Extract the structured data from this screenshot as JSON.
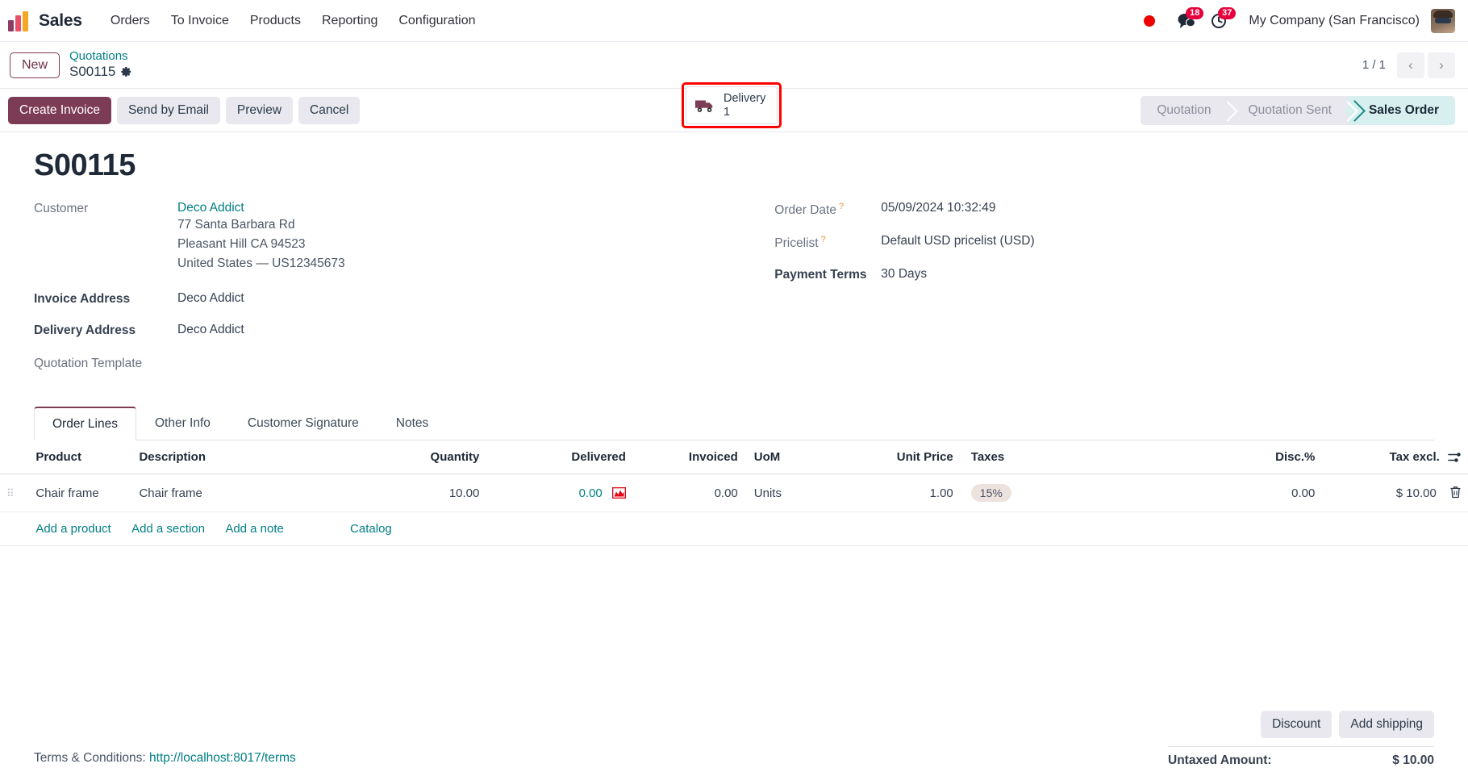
{
  "navbar": {
    "app_name": "Sales",
    "menu": [
      {
        "label": "Orders"
      },
      {
        "label": "To Invoice"
      },
      {
        "label": "Products"
      },
      {
        "label": "Reporting"
      },
      {
        "label": "Configuration"
      }
    ],
    "messages_badge": "18",
    "activities_badge": "37",
    "company": "My Company (San Francisco)",
    "recording_indicator": "recording-dot"
  },
  "control_panel": {
    "new_button": "New",
    "breadcrumb_parent": "Quotations",
    "breadcrumb_current": "S00115",
    "smart_button": {
      "label": "Delivery",
      "count": "1",
      "highlight_color": "#ff0000"
    },
    "pager": {
      "text": "1 / 1",
      "prev": "‹",
      "next": "›"
    }
  },
  "actions": {
    "buttons": [
      {
        "label": "Create Invoice",
        "primary": true
      },
      {
        "label": "Send by Email",
        "primary": false
      },
      {
        "label": "Preview",
        "primary": false
      },
      {
        "label": "Cancel",
        "primary": false
      }
    ]
  },
  "statusbar": {
    "steps": [
      {
        "label": "Quotation",
        "active": false
      },
      {
        "label": "Quotation Sent",
        "active": false
      },
      {
        "label": "Sales Order",
        "active": true
      }
    ],
    "active_color": "#d7f0ef"
  },
  "record": {
    "title": "S00115",
    "customer_label": "Customer",
    "customer_name": "Deco Addict",
    "address_line1": "77 Santa Barbara Rd",
    "address_line2": "Pleasant Hill CA 94523",
    "address_line3": "United States — US12345673",
    "invoice_address_label": "Invoice Address",
    "invoice_address_value": "Deco Addict",
    "delivery_address_label": "Delivery Address",
    "delivery_address_value": "Deco Addict",
    "quotation_template_label": "Quotation Template",
    "quotation_template_value": "",
    "order_date_label": "Order Date",
    "order_date_value": "05/09/2024 10:32:49",
    "pricelist_label": "Pricelist",
    "pricelist_value": "Default USD pricelist (USD)",
    "payment_terms_label": "Payment Terms",
    "payment_terms_value": "30 Days",
    "help_mark": "?"
  },
  "notebook": {
    "tabs": [
      {
        "label": "Order Lines",
        "active": true
      },
      {
        "label": "Other Info",
        "active": false
      },
      {
        "label": "Customer Signature",
        "active": false
      },
      {
        "label": "Notes",
        "active": false
      }
    ]
  },
  "lines_table": {
    "columns": [
      "Product",
      "Description",
      "Quantity",
      "Delivered",
      "Invoiced",
      "UoM",
      "Unit Price",
      "Taxes",
      "Disc.%",
      "Tax excl."
    ],
    "rows": [
      {
        "product": "Chair frame",
        "description": "Chair frame",
        "quantity": "10.00",
        "delivered": "0.00",
        "invoiced": "0.00",
        "uom": "Units",
        "unit_price": "1.00",
        "taxes": "15%",
        "discount": "0.00",
        "tax_excl": "$ 10.00"
      }
    ],
    "add_links": [
      {
        "label": "Add a product"
      },
      {
        "label": "Add a section"
      },
      {
        "label": "Add a note"
      },
      {
        "label": "Catalog"
      }
    ]
  },
  "totals": {
    "discount_button": "Discount",
    "add_shipping_button": "Add shipping",
    "untaxed_label": "Untaxed Amount:",
    "untaxed_value": "$ 10.00"
  },
  "terms": {
    "prefix": "Terms & Conditions:",
    "url": "http://localhost:8017/terms"
  }
}
